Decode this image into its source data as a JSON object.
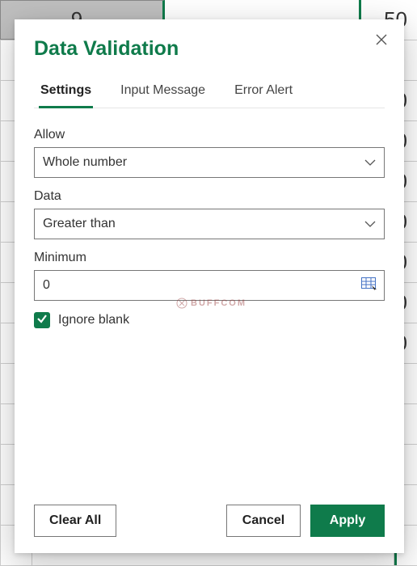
{
  "background": {
    "top_left_value": "9",
    "top_right_value": "50",
    "side_value": "0"
  },
  "dialog": {
    "title": "Data Validation",
    "tabs": {
      "settings": "Settings",
      "input_message": "Input Message",
      "error_alert": "Error Alert",
      "active": "settings"
    },
    "fields": {
      "allow_label": "Allow",
      "allow_value": "Whole number",
      "data_label": "Data",
      "data_value": "Greater than",
      "minimum_label": "Minimum",
      "minimum_value": "0"
    },
    "checkbox": {
      "ignore_blank_label": "Ignore blank",
      "ignore_blank_checked": true
    },
    "buttons": {
      "clear_all": "Clear All",
      "cancel": "Cancel",
      "apply": "Apply"
    }
  },
  "watermark": "BUFFCOM"
}
